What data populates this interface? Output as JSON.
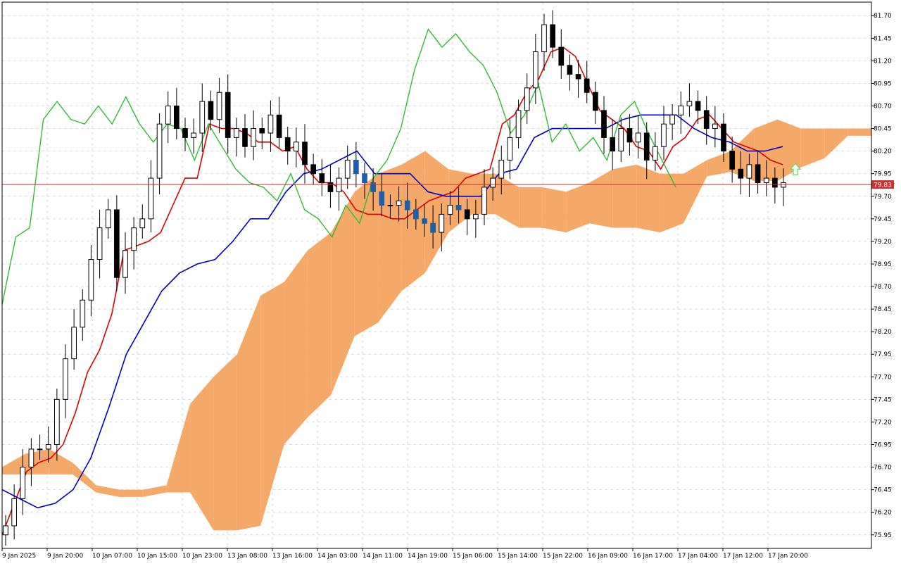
{
  "chart_data": {
    "type": "candlestick",
    "title": "",
    "xlabel": "",
    "ylabel": "",
    "ylim": [
      75.8,
      81.85
    ],
    "y_ticks": [
      "81.70",
      "81.45",
      "81.20",
      "80.95",
      "80.70",
      "80.45",
      "80.20",
      "79.95",
      "79.70",
      "79.45",
      "79.20",
      "78.95",
      "78.70",
      "78.45",
      "78.20",
      "77.95",
      "77.70",
      "77.45",
      "77.20",
      "76.95",
      "76.70",
      "76.45",
      "76.20",
      "75.95"
    ],
    "x_ticks": [
      "9 Jan 2025",
      "9 Jan 20:00",
      "10 Jan 07:00",
      "10 Jan 15:00",
      "10 Jan 23:00",
      "13 Jan 08:00",
      "13 Jan 16:00",
      "14 Jan 03:00",
      "14 Jan 11:00",
      "14 Jan 19:00",
      "15 Jan 06:00",
      "15 Jan 14:00",
      "15 Jan 22:00",
      "16 Jan 09:00",
      "16 Jan 17:00",
      "17 Jan 04:00",
      "17 Jan 12:00",
      "17 Jan 20:00"
    ],
    "current_price": "79.83",
    "grid": true,
    "colors": {
      "bull_candle": "#ffffff",
      "bear_candle": "#000000",
      "highlight_candle": "#1f5fa8",
      "tenkan": "#e00000",
      "kijun": "#0000cc",
      "chikou": "#33bb33",
      "kumo_bull": "#f4a460",
      "kumo_bear": "#d8bfd8",
      "price_line": "#c83232",
      "signal_arrow": "#66dd66"
    },
    "series": [
      {
        "kind": "close",
        "values": [
          76.05,
          76.35,
          76.7,
          76.9,
          76.9,
          76.95,
          77.45,
          77.9,
          78.25,
          78.55,
          79.0,
          79.35,
          79.55,
          78.8,
          79.1,
          79.35,
          79.45,
          79.9,
          80.5,
          80.7,
          80.45,
          80.35,
          80.4,
          80.75,
          80.55,
          80.85,
          80.35,
          80.45,
          80.25,
          80.45,
          80.4,
          80.6,
          80.35,
          80.2,
          80.3,
          80.05,
          79.95,
          79.85,
          79.75,
          79.9,
          80.1,
          79.95,
          79.85,
          79.75,
          79.6,
          79.6,
          79.65,
          79.55,
          79.45,
          79.4,
          79.3,
          79.5,
          79.6,
          79.55,
          79.45,
          79.5,
          79.8,
          79.9,
          80.1,
          80.35,
          80.65,
          80.9,
          81.3,
          81.6,
          81.35,
          81.15,
          81.05,
          81.0,
          80.85,
          80.65,
          80.35,
          80.2,
          80.45,
          80.3,
          80.4,
          80.1,
          80.25,
          80.5,
          80.6,
          80.7,
          80.75,
          80.65,
          80.45,
          80.5,
          80.2,
          80.0,
          79.9,
          80.05,
          79.85,
          79.9,
          79.8,
          79.85
        ],
        "source": "estimated"
      }
    ],
    "lines": {
      "tenkan": {
        "name": "",
        "values": [
          75.95,
          76.3,
          76.65,
          76.75,
          76.8,
          76.95,
          77.3,
          77.75,
          78.0,
          78.4,
          79.1,
          79.15,
          79.2,
          79.3,
          79.6,
          79.9,
          79.9,
          80.5,
          80.45,
          80.45,
          80.4,
          80.3,
          80.3,
          80.2,
          80.25,
          80.0,
          79.85,
          79.85,
          79.75,
          79.55,
          79.5,
          79.5,
          79.45,
          79.45,
          79.55,
          79.65,
          79.7,
          79.75,
          79.9,
          79.95,
          80.0,
          80.5,
          80.6,
          80.85,
          81.0,
          81.3,
          81.35,
          81.25,
          80.95,
          80.65,
          80.55,
          80.45,
          80.25,
          80.2,
          80.0,
          80.25,
          80.35,
          80.55,
          80.6,
          80.45,
          80.3,
          80.25,
          80.2,
          80.1,
          80.05
        ],
        "source": "estimated"
      },
      "kijun": {
        "name": "",
        "values": [
          76.45,
          76.35,
          76.25,
          76.3,
          76.45,
          76.8,
          77.35,
          77.95,
          78.3,
          78.65,
          78.85,
          78.95,
          79.0,
          79.2,
          79.45,
          79.45,
          79.75,
          79.95,
          80.0,
          80.1,
          80.2,
          79.95,
          79.95,
          79.95,
          79.75,
          79.7,
          79.7,
          79.7,
          79.95,
          80.0,
          80.35,
          80.45,
          80.45,
          80.45,
          80.45,
          80.55,
          80.6,
          80.6,
          80.6,
          80.45,
          80.35,
          80.3,
          80.2,
          80.2,
          80.25
        ],
        "source": "estimated"
      },
      "chikou": {
        "name": "",
        "values": [
          78.5,
          79.25,
          79.35,
          80.55,
          80.75,
          80.55,
          80.5,
          80.7,
          80.5,
          80.8,
          80.5,
          80.3,
          80.5,
          80.45,
          80.1,
          80.5,
          80.25,
          80.0,
          79.85,
          79.8,
          79.65,
          79.95,
          79.55,
          79.45,
          79.25,
          79.6,
          79.4,
          79.9,
          80.1,
          80.45,
          81.1,
          81.55,
          81.35,
          81.5,
          81.3,
          81.15,
          80.85,
          80.4,
          80.6,
          80.95,
          80.3,
          80.5,
          80.2,
          80.35,
          80.1,
          80.6,
          80.75,
          80.4,
          80.1,
          79.8
        ],
        "source": "estimated"
      }
    },
    "kumo": {
      "span_a": [
        76.7,
        76.85,
        76.9,
        76.75,
        76.5,
        76.45,
        76.45,
        76.5,
        77.4,
        77.7,
        77.95,
        78.6,
        78.75,
        79.1,
        79.3,
        79.75,
        79.95,
        80.05,
        80.2,
        80.0,
        79.95,
        79.95,
        79.8,
        79.8,
        79.75,
        79.85,
        80.0,
        80.05,
        79.95,
        79.95,
        80.1,
        80.2,
        80.45,
        80.55,
        80.45,
        80.45,
        80.45,
        80.45
      ],
      "source": "estimated"
    }
  }
}
